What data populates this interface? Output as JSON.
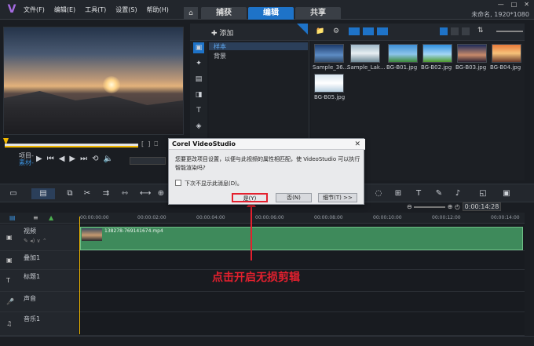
{
  "app": {
    "logo_icon": "videostudio-logo-icon",
    "project_status": "未命名, 1920*1080"
  },
  "menu": [
    "文件(F)",
    "编辑(E)",
    "工具(T)",
    "设置(S)",
    "帮助(H)"
  ],
  "tabs": [
    {
      "label": "捕获",
      "active": false
    },
    {
      "label": "编辑",
      "active": true
    },
    {
      "label": "共享",
      "active": false
    }
  ],
  "player": {
    "project_label": "项目-",
    "clip_label": "素材-",
    "time_icon": "timecode-icon"
  },
  "library": {
    "add_label": "添加",
    "folders": [
      "样本",
      "背景"
    ],
    "thumbnails": [
      {
        "label": "Sample_36..."
      },
      {
        "label": "Sample_Lak..."
      },
      {
        "label": "BG-B01.jpg"
      },
      {
        "label": "BG-B02.jpg"
      },
      {
        "label": "BG-B03.jpg"
      },
      {
        "label": "BG-B04.jpg"
      },
      {
        "label": "BG-B05.jpg"
      }
    ]
  },
  "ruler": [
    "00:00:00:00",
    "00:00:02:00",
    "00:00:04:00",
    "00:00:06:00",
    "00:00:08:00",
    "00:00:10:00",
    "00:00:12:00",
    "00:00:14:00"
  ],
  "zoom_time": "0:00:14:28",
  "tracks": [
    {
      "name": "视频"
    },
    {
      "name": "叠加1"
    },
    {
      "name": "标题1"
    },
    {
      "name": "声音"
    },
    {
      "name": "音乐1"
    }
  ],
  "clip": {
    "label": "138278-769141674.mp4"
  },
  "dialog": {
    "title": "Corel VideoStudio",
    "message": "您要更改项目设置，以便与此视频的属性相匹配，使 VideoStudio 可以执行智能渲染吗?",
    "checkbox": "下次不显示此消息(D)。",
    "yes": "是(Y)",
    "no": "否(N)",
    "details": "细节(T) >>"
  },
  "annotation": "点击开启无损剪辑",
  "colors": {
    "accent": "#1e73c8",
    "annotation": "#e4202e",
    "clip": "#3e8a5b"
  }
}
